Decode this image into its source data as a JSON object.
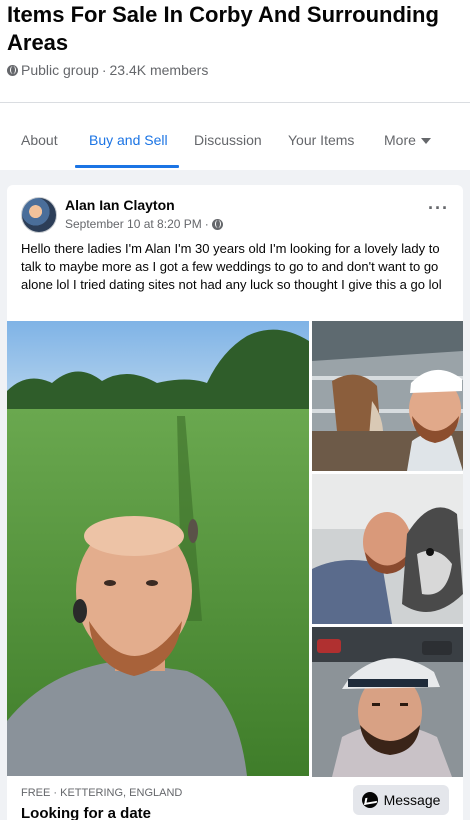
{
  "group": {
    "title": "Items For Sale In Corby And Surrounding Areas",
    "privacy": "Public group",
    "separator": "·",
    "members": "23.4K members"
  },
  "tabs": [
    {
      "label": "About",
      "active": false
    },
    {
      "label": "Buy and Sell",
      "active": true
    },
    {
      "label": "Discussion",
      "active": false
    },
    {
      "label": "Your Items",
      "active": false
    },
    {
      "label": "More",
      "active": false
    }
  ],
  "post": {
    "author": "Alan Ian Clayton",
    "timestamp": "September 10 at 8:20 PM",
    "separator": "·",
    "more_icon": "more-horizontal-icon",
    "text": "Hello there ladies I'm Alan I'm 30 years old  I'm looking for a lovely lady to talk to maybe more as I got a few weddings to go to and don't want to go alone lol I tried dating sites not had any luck so thought I give this a go lol",
    "photos": [
      {
        "name": "selfie-in-field-photo"
      },
      {
        "name": "selfie-with-horse-photo"
      },
      {
        "name": "selfie-with-dog-photo"
      },
      {
        "name": "selfie-in-car-park-photo"
      }
    ]
  },
  "listing": {
    "meta": "FREE · KETTERING, ENGLAND",
    "title": "Looking for a date",
    "message_label": "Message",
    "message_icon": "messenger-icon"
  },
  "colors": {
    "accent": "#1b74e4",
    "secondary_text": "#65676b",
    "background": "#f0f2f5"
  }
}
